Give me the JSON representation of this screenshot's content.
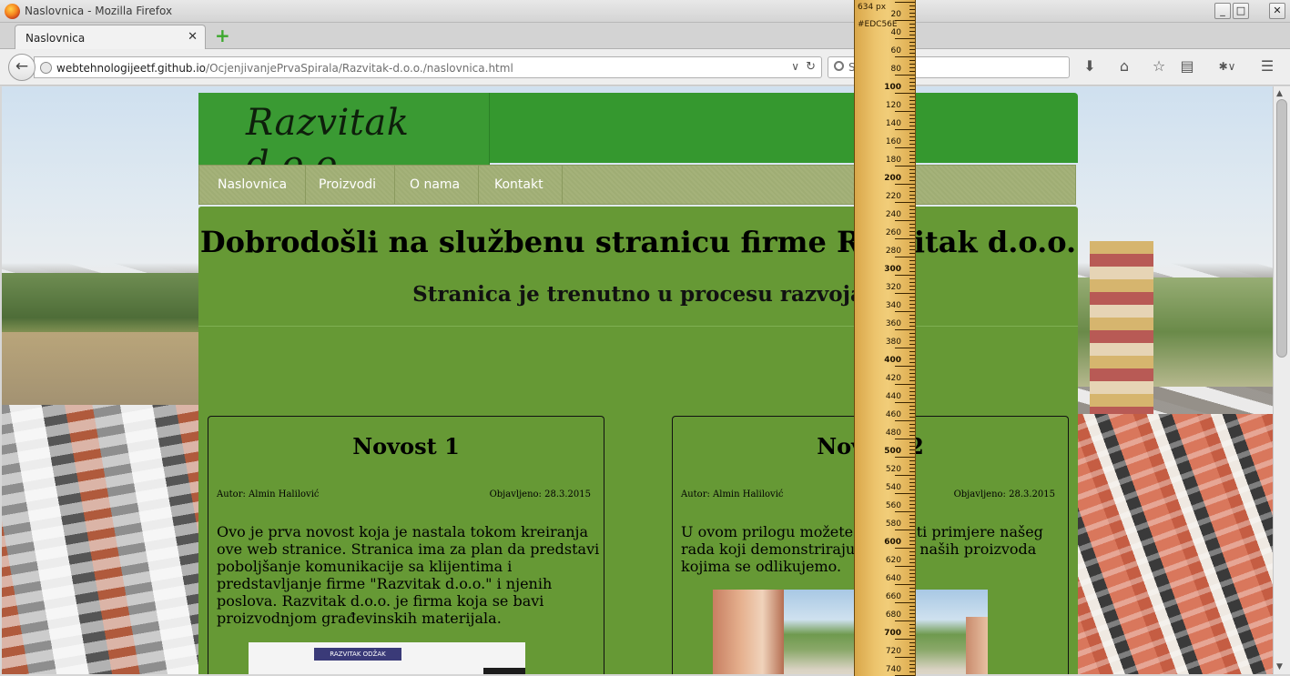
{
  "window": {
    "title": "Naslovnica - Mozilla Firefox",
    "minimize": "_",
    "maximize": "□",
    "close": "✕"
  },
  "tabs": [
    {
      "label": "Naslovnica",
      "close": "✕"
    }
  ],
  "new_tab": "+",
  "navigation": {
    "back": "←",
    "url_host": "webtehnologijeetf.github.io",
    "url_path": "/OcjenjivanjePrvaSpirala/Razvitak-d.o.o./naslovnica.html",
    "url_dropdown": "∨",
    "reload": "↻",
    "search_placeholder": "S",
    "tools": [
      "download-icon",
      "home-icon",
      "bookmark-star-icon",
      "reading-list-icon",
      "extension-icon",
      "menu-icon"
    ],
    "tool_glyphs": {
      "download": "⬇",
      "home": "⌂",
      "bookmark": "☆",
      "reading": "▤",
      "extension": "✱∨",
      "menu": "☰"
    }
  },
  "site": {
    "logo": "Razvitak d.o.o.",
    "menu": [
      "Naslovnica",
      "Proizvodi",
      "O nama",
      "Kontakt"
    ],
    "heading": "Dobrodošli na službenu stranicu firme Razvitak d.o.o.",
    "subheading": "Stranica je trenutno u procesu razvoja",
    "news": [
      {
        "title": "Novost 1",
        "author": "Autor: Almin Halilović",
        "date": "Objavljeno: 28.3.2015",
        "body": "Ovo je prva novost koja je nastala tokom kreiranja ove web stranice. Stranica ima za plan da predstavi poboljšanje komunikacije sa klijentima i predstavljanje firme \"Razvitak d.o.o.\" i njenih poslova. Razvitak d.o.o. je firma koja se bavi proizvodnjom građevinskih materijala.",
        "image_sign": "RAZVITAK ODŽAK"
      },
      {
        "title": "Novost 2",
        "author": "Autor: Almin Halilović",
        "date": "Objavljeno: 28.3.2015",
        "body": "U ovom prilogu možete pogledati primjere našeg rada koji demonstriraju kvalitet naših proizvoda kojima se odlikujemo."
      }
    ]
  },
  "ruler": {
    "size_label": "634 px",
    "color_label": "#EDC56E",
    "ticks": [
      "20",
      "40",
      "60",
      "80",
      "100",
      "120",
      "140",
      "160",
      "180",
      "200",
      "220",
      "240",
      "260",
      "280",
      "300",
      "320",
      "340",
      "360",
      "380",
      "400",
      "420",
      "440",
      "460",
      "480",
      "500",
      "520",
      "540",
      "560",
      "580",
      "600",
      "620",
      "640",
      "660",
      "680",
      "700",
      "720",
      "740"
    ]
  },
  "scrollbar": {
    "up": "▲",
    "down": "▼"
  },
  "colors": {
    "header_green": "#35982F",
    "content_green": "#669935",
    "menu_bg": "#A5B27A",
    "ruler": "#EDC56E"
  }
}
